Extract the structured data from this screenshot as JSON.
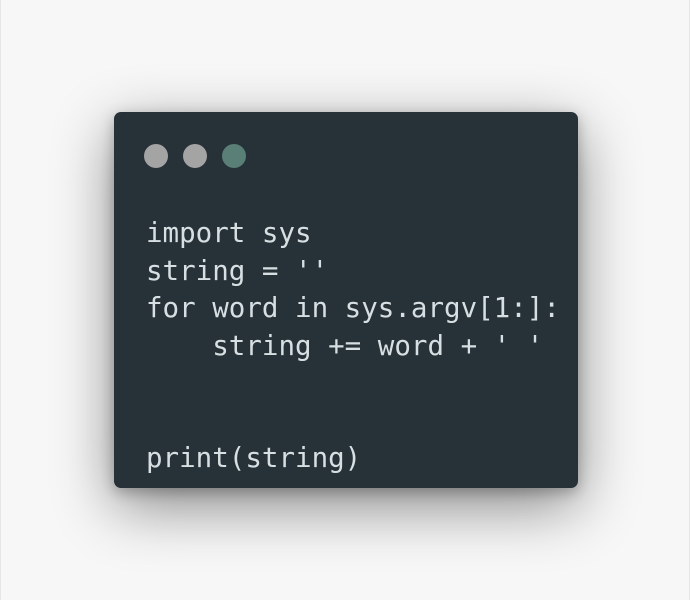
{
  "window": {
    "controls": [
      {
        "name": "window-close-dot",
        "color": "#a4a4a4"
      },
      {
        "name": "window-minimize-dot",
        "color": "#a4a4a4"
      },
      {
        "name": "window-maximize-dot",
        "color": "#5a7f76"
      }
    ]
  },
  "code": {
    "lines": [
      "import sys",
      "string = ''",
      "for word in sys.argv[1:]:",
      "    string += word + ' '",
      "",
      "",
      "print(string)"
    ]
  },
  "theme": {
    "background": "#263238",
    "text": "#d7dfe2"
  }
}
